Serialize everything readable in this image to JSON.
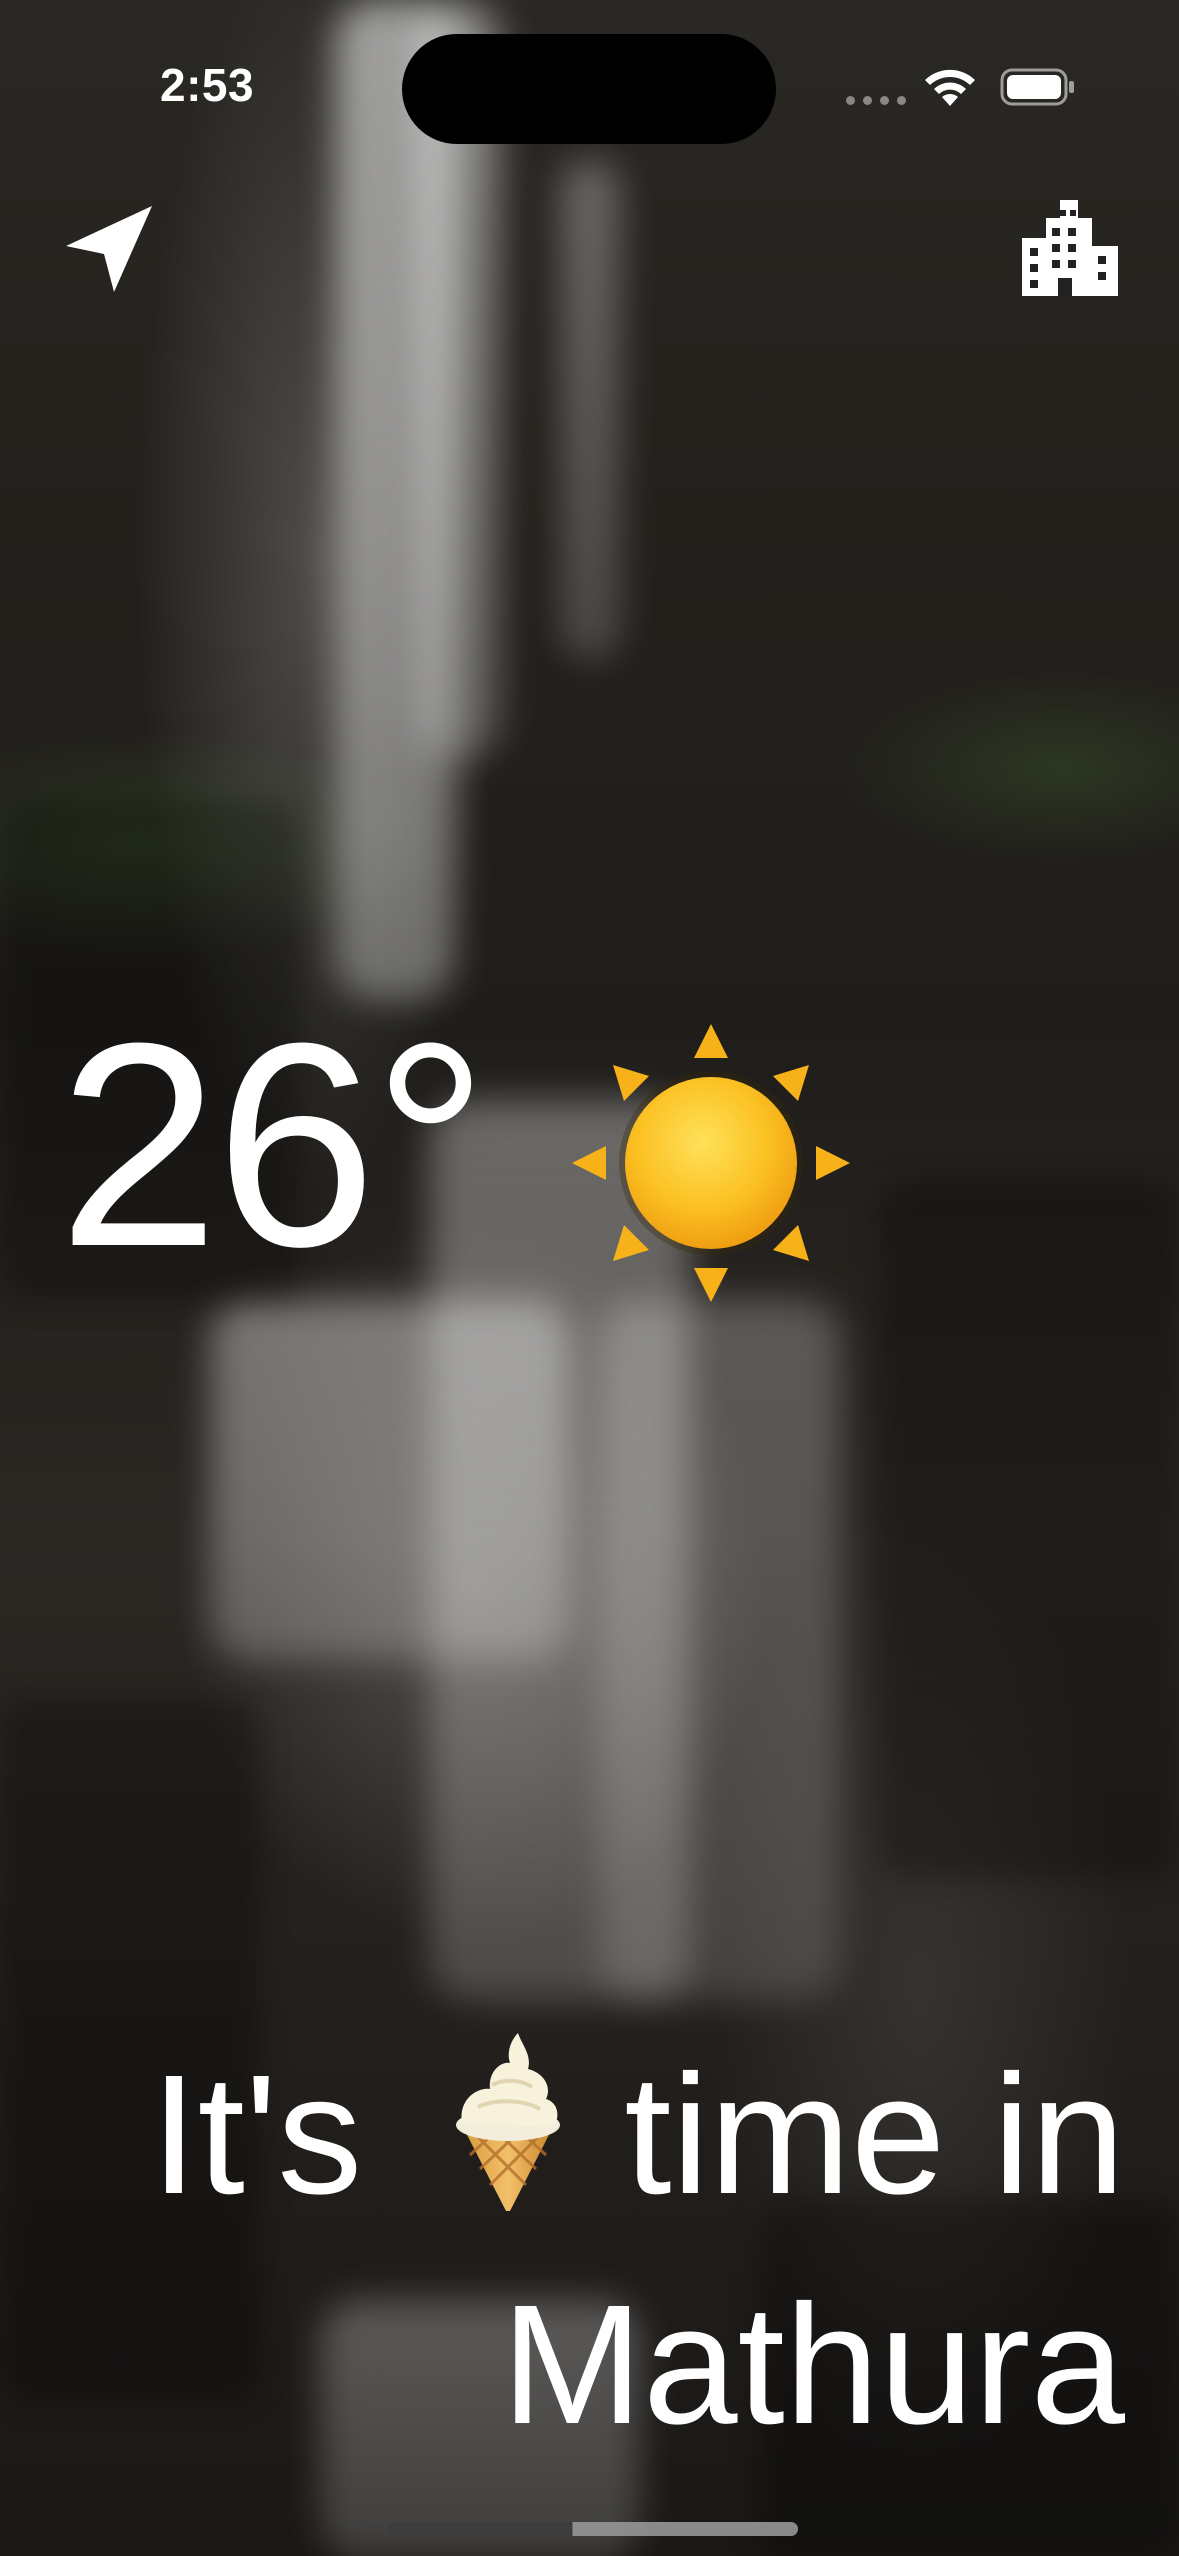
{
  "status_bar": {
    "time": "2:53"
  },
  "toolbar": {
    "location_icon": "location-arrow-icon",
    "city_icon": "building-icon"
  },
  "weather": {
    "temperature": "26°",
    "condition_icon": "sun-icon"
  },
  "message": {
    "prefix": "It's",
    "emoji_icon": "ice-cream-icon",
    "suffix": "time in",
    "city": "Mathura"
  },
  "colors": {
    "text": "#ffffff",
    "sun": "#f7b21a",
    "island": "#000000"
  }
}
